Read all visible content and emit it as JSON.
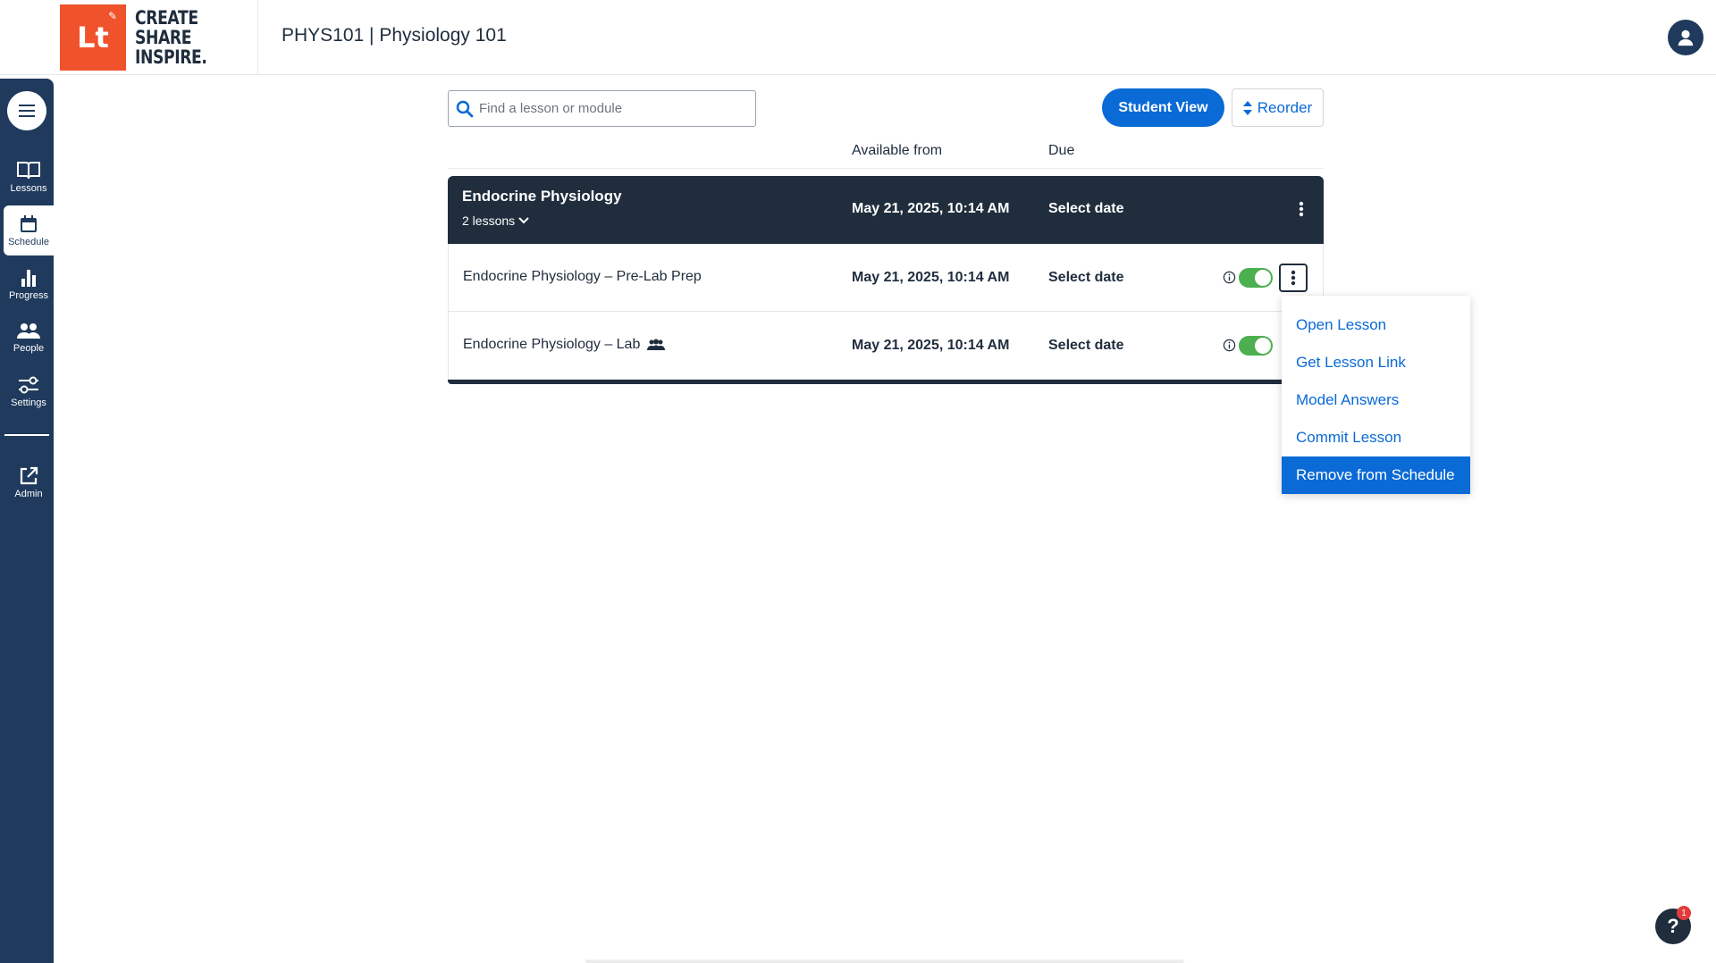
{
  "header": {
    "logo_mark": "Lt",
    "logo_lines": [
      "CREATE",
      "SHARE",
      "INSPIRE."
    ],
    "course_title": "PHYS101 | Physiology 101"
  },
  "sidebar": {
    "items": [
      {
        "label": "Lessons",
        "icon": "book-icon"
      },
      {
        "label": "Schedule",
        "icon": "calendar-icon",
        "active": true
      },
      {
        "label": "Progress",
        "icon": "bar-chart-icon"
      },
      {
        "label": "People",
        "icon": "people-icon"
      },
      {
        "label": "Settings",
        "icon": "sliders-icon"
      },
      {
        "label": "Admin",
        "icon": "external-link-icon"
      }
    ]
  },
  "search": {
    "placeholder": "Find a lesson or module",
    "value": ""
  },
  "actions": {
    "student_view": "Student View",
    "reorder": "Reorder"
  },
  "columns": {
    "available_from": "Available from",
    "due": "Due"
  },
  "module": {
    "name": "Endocrine Physiology",
    "count": "2 lessons",
    "available_from": "May 21, 2025, 10:14 AM",
    "due": "Select date"
  },
  "lessons": [
    {
      "name": "Endocrine Physiology – Pre-Lab Prep",
      "available_from": "May 21, 2025, 10:14 AM",
      "due": "Select date",
      "published": true,
      "group": false
    },
    {
      "name": "Endocrine Physiology – Lab",
      "available_from": "May 21, 2025, 10:14 AM",
      "due": "Select date",
      "published": true,
      "group": true
    }
  ],
  "context_menu": {
    "items": [
      "Open Lesson",
      "Get Lesson Link",
      "Model Answers",
      "Commit Lesson",
      "Remove from Schedule"
    ],
    "highlighted": "Remove from Schedule"
  },
  "help": {
    "label": "?",
    "badge": "1"
  },
  "colors": {
    "primary": "#0a6ad6",
    "sidebar": "#1f3a5c",
    "brand": "#f0522b",
    "toggle_on": "#4caf50"
  }
}
